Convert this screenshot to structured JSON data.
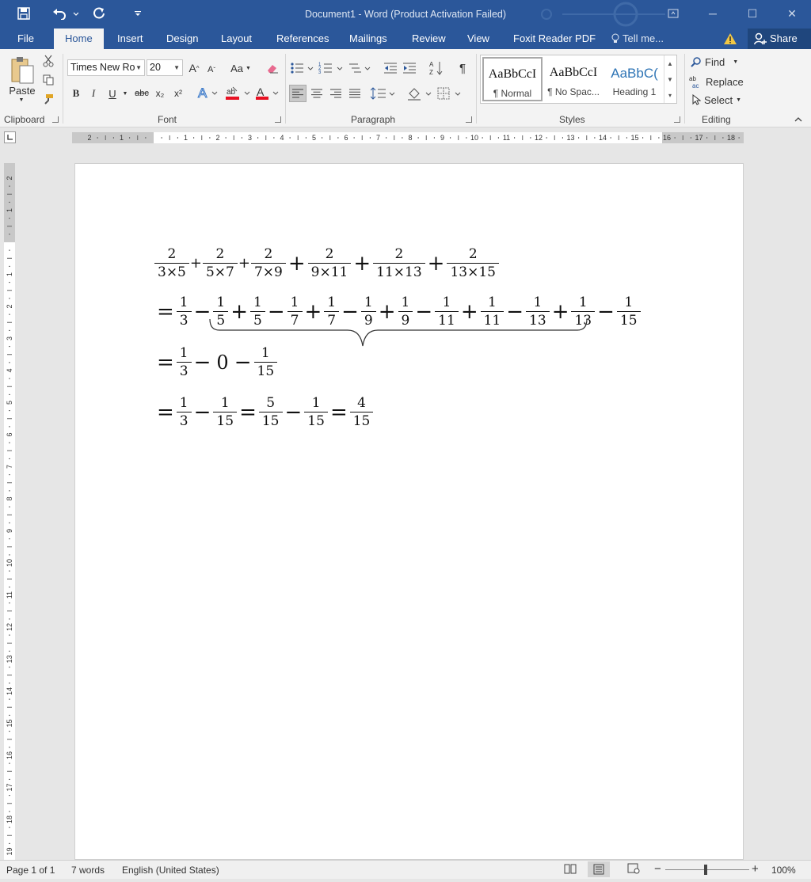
{
  "titlebar": {
    "title": "Document1 - Word (Product Activation Failed)",
    "minimize": "─",
    "maximize": "☐",
    "close": "✕"
  },
  "tabs": [
    {
      "label": "File"
    },
    {
      "label": "Home"
    },
    {
      "label": "Insert"
    },
    {
      "label": "Design"
    },
    {
      "label": "Layout"
    },
    {
      "label": "References"
    },
    {
      "label": "Mailings"
    },
    {
      "label": "Review"
    },
    {
      "label": "View"
    },
    {
      "label": "Foxit Reader PDF"
    }
  ],
  "tell_me": "Tell me...",
  "share": "Share",
  "ribbon": {
    "clipboard": {
      "label": "Clipboard",
      "paste": "Paste"
    },
    "font": {
      "label": "Font",
      "font_name": "Times New Ro",
      "font_size": "20",
      "grow": "A",
      "shrink": "A",
      "change_case": "Aa",
      "bold": "B",
      "italic": "I",
      "underline": "U",
      "strike": "abc",
      "subscript": "x₂",
      "superscript": "x²",
      "font_color": "A",
      "highlight_color": "#ff0000",
      "font_color_bar": "#e81123"
    },
    "paragraph": {
      "label": "Paragraph",
      "pilcrow": "¶"
    },
    "styles": {
      "label": "Styles",
      "items": [
        {
          "sample": "AaBbCcI",
          "name": "¶ Normal"
        },
        {
          "sample": "AaBbCcI",
          "name": "¶ No Spac..."
        },
        {
          "sample": "AaBbC(",
          "name": "Heading 1"
        }
      ]
    },
    "editing": {
      "label": "Editing",
      "find": "Find",
      "replace": "Replace",
      "select": "Select"
    }
  },
  "math": {
    "line1": [
      {
        "n": "2",
        "d": "3×5"
      },
      {
        "op": "+"
      },
      {
        "n": "2",
        "d": "5×7"
      },
      {
        "op": "+"
      },
      {
        "n": "2",
        "d": "7×9"
      },
      {
        "op": "+"
      },
      {
        "n": "2",
        "d": "9×11"
      },
      {
        "op": "+"
      },
      {
        "n": "2",
        "d": "11×13"
      },
      {
        "op": "+"
      },
      {
        "n": "2",
        "d": "13×15"
      }
    ],
    "line2": [
      {
        "op": "="
      },
      {
        "n": "1",
        "d": "3"
      },
      {
        "op": "−"
      },
      {
        "n": "1",
        "d": "5"
      },
      {
        "op": "+"
      },
      {
        "n": "1",
        "d": "5"
      },
      {
        "op": "−"
      },
      {
        "n": "1",
        "d": "7"
      },
      {
        "op": "+"
      },
      {
        "n": "1",
        "d": "7"
      },
      {
        "op": "−"
      },
      {
        "n": "1",
        "d": "9"
      },
      {
        "op": "+"
      },
      {
        "n": "1",
        "d": "9"
      },
      {
        "op": "−"
      },
      {
        "n": "1",
        "d": "11"
      },
      {
        "op": "+"
      },
      {
        "n": "1",
        "d": "11"
      },
      {
        "op": "−"
      },
      {
        "n": "1",
        "d": "13"
      },
      {
        "op": "+"
      },
      {
        "n": "1",
        "d": "13"
      },
      {
        "op": "−"
      },
      {
        "n": "1",
        "d": "15"
      }
    ],
    "line3": [
      {
        "op": "="
      },
      {
        "n": "1",
        "d": "3"
      },
      {
        "op": "−"
      },
      {
        "z": "0"
      },
      {
        "op": "−"
      },
      {
        "n": "1",
        "d": "15"
      }
    ],
    "line4": [
      {
        "op": "="
      },
      {
        "n": "1",
        "d": "3"
      },
      {
        "op": "−"
      },
      {
        "n": "1",
        "d": "15"
      },
      {
        "op": "="
      },
      {
        "n": "5",
        "d": "15"
      },
      {
        "op": "−"
      },
      {
        "n": "1",
        "d": "15"
      },
      {
        "op": "="
      },
      {
        "n": "4",
        "d": "15"
      }
    ]
  },
  "status": {
    "page": "Page 1 of 1",
    "words": "7 words",
    "language": "English (United States)",
    "zoom": "100%",
    "zoom_minus": "−",
    "zoom_plus": "+"
  }
}
